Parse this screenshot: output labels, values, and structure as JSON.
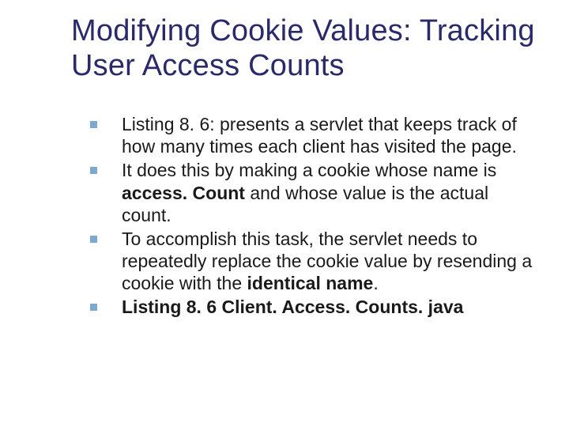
{
  "slide": {
    "title": "Modifying Cookie Values: Tracking User Access Counts",
    "bullets": [
      {
        "pre": "Listing 8. 6: presents a servlet that keeps track of how many times each client has visited the page.",
        "bold": "",
        "post": ""
      },
      {
        "pre": "It does this by making a cookie whose name is ",
        "bold": "access. Count",
        "post": " and whose value is the actual count."
      },
      {
        "pre": "To accomplish this task, the servlet needs to repeatedly replace the cookie value by resending a cookie with the ",
        "bold": "identical name",
        "post": "."
      },
      {
        "pre": "",
        "bold": "Listing 8. 6 Client. Access. Counts. java",
        "post": ""
      }
    ]
  }
}
